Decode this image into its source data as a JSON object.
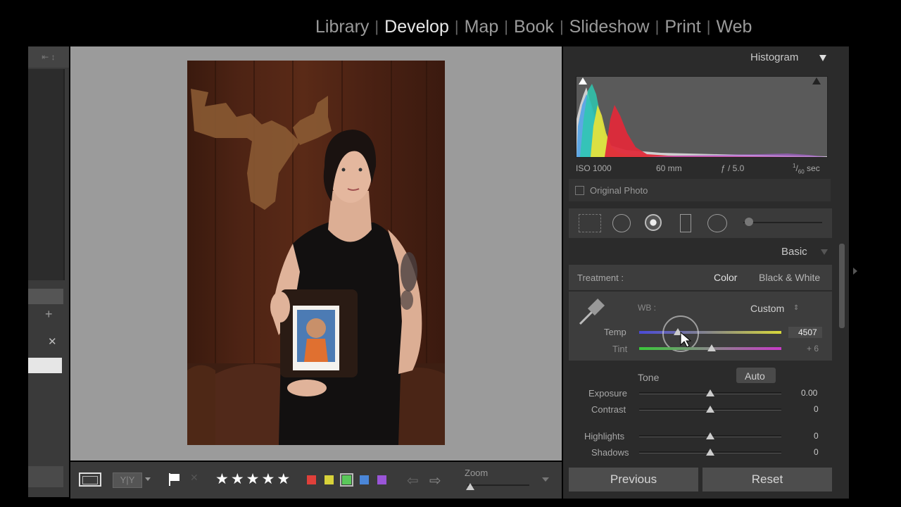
{
  "modules": [
    {
      "label": "Library",
      "active": false
    },
    {
      "label": "Develop",
      "active": true
    },
    {
      "label": "Map",
      "active": false
    },
    {
      "label": "Book",
      "active": false
    },
    {
      "label": "Slideshow",
      "active": false
    },
    {
      "label": "Print",
      "active": false
    },
    {
      "label": "Web",
      "active": false
    }
  ],
  "histogram": {
    "title": "Histogram",
    "iso": "ISO 1000",
    "focal": "60 mm",
    "aperture": "ƒ / 5.0",
    "shutter_num": "1",
    "shutter_den": "60",
    "shutter_unit": " sec",
    "original_photo_label": "Original Photo"
  },
  "basic": {
    "title": "Basic",
    "treatment_label": "Treatment :",
    "treatment_color": "Color",
    "treatment_bw": "Black & White",
    "wb_label": "WB :",
    "wb_value": "Custom",
    "temp_label": "Temp",
    "temp_value": "4507",
    "temp_level": 0.27,
    "tint_label": "Tint",
    "tint_value": "+ 6",
    "tint_level": 0.51,
    "tone_label": "Tone",
    "auto_label": "Auto",
    "exposure_label": "Exposure",
    "exposure_value": "0.00",
    "contrast_label": "Contrast",
    "contrast_value": "0",
    "highlights_label": "Highlights",
    "highlights_value": "0",
    "shadows_label": "Shadows",
    "shadows_value": "0"
  },
  "toolbar": {
    "zoom_label": "Zoom",
    "stars": [
      "★",
      "★",
      "★",
      "★",
      "★"
    ],
    "color_labels": [
      "#e0403a",
      "#d8d23a",
      "#5ac85a",
      "#4a86d8",
      "#9a55d8"
    ]
  },
  "buttons": {
    "previous": "Previous",
    "reset": "Reset"
  },
  "icons": {
    "left_collapse": "⇤ ↕",
    "left_plus": "+",
    "left_x": "✕"
  }
}
